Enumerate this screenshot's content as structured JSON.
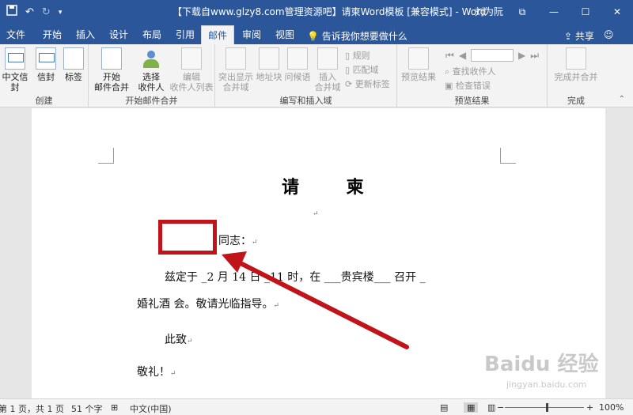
{
  "titlebar": {
    "save_icon": "save-icon",
    "undo_glyph": "↶",
    "redo_glyph": "↻",
    "title": "【下载自www.glzy8.com管理资源吧】请柬Word模板 [兼容模式] - Word",
    "user": "刘为阮",
    "controls": [
      "⧉",
      "—",
      "☐",
      "✕"
    ]
  },
  "tabs": [
    {
      "label": "文件"
    },
    {
      "label": "开始"
    },
    {
      "label": "插入"
    },
    {
      "label": "设计"
    },
    {
      "label": "布局"
    },
    {
      "label": "引用"
    },
    {
      "label": "邮件"
    },
    {
      "label": "审阅"
    },
    {
      "label": "视图"
    }
  ],
  "tellme": "告诉我你想要做什么",
  "share": "共享",
  "ribbon": {
    "create": {
      "label": "创建",
      "chinese_envelope": "中文信封",
      "envelope": "信封",
      "labels_btn": "标签"
    },
    "start_merge": {
      "label": "开始邮件合并",
      "start_line1": "开始",
      "start_line2": "邮件合并",
      "select_line1": "选择",
      "select_line2": "收件人",
      "edit_line1": "编辑",
      "edit_line2": "收件人列表"
    },
    "write_insert": {
      "label": "编写和插入域",
      "highlight_line1": "突出显示",
      "highlight_line2": "合并域",
      "address_block": "地址块",
      "greeting_line": "问候语",
      "insert_line1": "插入",
      "insert_line2": "合并域",
      "rules": "规则",
      "match_fields": "匹配域",
      "update_labels": "更新标签"
    },
    "preview": {
      "label": "预览结果",
      "preview_results": "预览结果",
      "find_recipient": "查找收件人",
      "check_errors": "检查错误"
    },
    "finish": {
      "label": "完成",
      "finish_merge": "完成并合并"
    }
  },
  "document": {
    "title": "请 柬",
    "salutation_suffix": "同志：",
    "body_line1": "兹定于 _2 月 14 日 _11 时，在 ___贵宾楼___ 召开 _",
    "body_line2": "婚礼酒 会。敬请光临指导。",
    "closing": "此致",
    "regards": "敬礼！",
    "para_mark": "↵"
  },
  "watermark": {
    "main": "Baidu 经验",
    "sub": "jingyan.baidu.com"
  },
  "statusbar": {
    "page": "第 1 页，共 1 页",
    "words": "51 个字",
    "language": "中文(中国)",
    "zoom": "100%",
    "zoom_minus": "−",
    "zoom_plus": "+"
  }
}
